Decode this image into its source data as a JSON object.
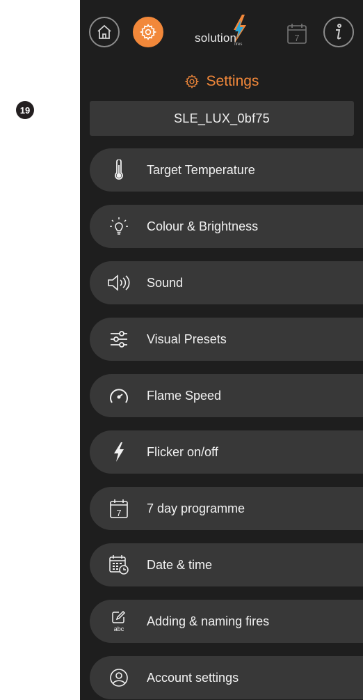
{
  "page_number": "19",
  "header": {
    "logo_text": "solution",
    "logo_subtext": "fires",
    "calendar_day": "7",
    "accent_color": "#f2883a"
  },
  "title": "Settings",
  "device_name": "SLE_LUX_0bf75",
  "menu": [
    {
      "label": "Target Temperature",
      "icon": "thermometer-icon"
    },
    {
      "label": "Colour & Brightness",
      "icon": "lightbulb-icon"
    },
    {
      "label": "Sound",
      "icon": "speaker-icon"
    },
    {
      "label": "Visual Presets",
      "icon": "sliders-icon"
    },
    {
      "label": "Flame Speed",
      "icon": "speedometer-icon"
    },
    {
      "label": "Flicker on/off",
      "icon": "lightning-bolt-icon"
    },
    {
      "label": "7 day programme",
      "icon": "calendar-icon",
      "icon_text": "7"
    },
    {
      "label": "Date & time",
      "icon": "calendar-clock-icon"
    },
    {
      "label": "Adding & naming fires",
      "icon": "edit-name-icon",
      "icon_text": "abc"
    },
    {
      "label": "Account settings",
      "icon": "user-icon"
    }
  ]
}
